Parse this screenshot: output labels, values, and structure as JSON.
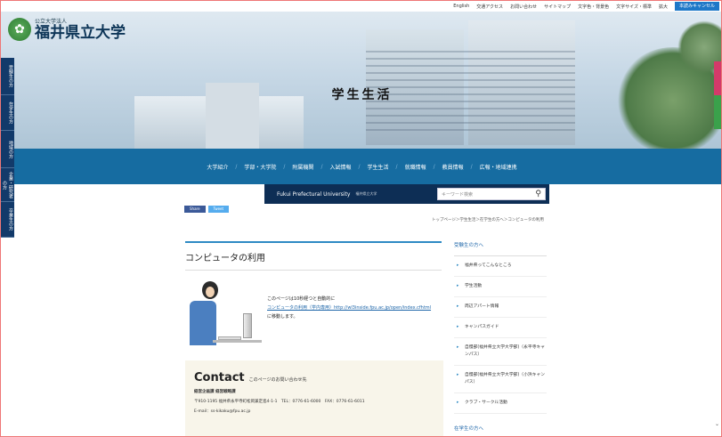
{
  "topbar": {
    "links": [
      "English",
      "交通アクセス",
      "お問い合わせ",
      "サイトマップ",
      "文字色・背景色",
      "文字サイズ・標準",
      "拡大"
    ],
    "cancel_label": "本読みキャンセル"
  },
  "logo": {
    "sub": "公立大学法人",
    "main": "福井県立大学"
  },
  "page_heading": "学生生活",
  "side_tabs": [
    "受験生の方",
    "在学生の方",
    "地域の方",
    "企業・研究者の方",
    "卒業生の方"
  ],
  "nav": {
    "items": [
      "大学紹介",
      "学部・大学院",
      "附属機関",
      "入試情報",
      "学生生活",
      "就職情報",
      "教員情報",
      "広報・地域連携"
    ]
  },
  "subbar": {
    "name": "Fukui Prefectural University",
    "small": "福井県立大学"
  },
  "search": {
    "placeholder": "キーワード検索",
    "icon": "search-icon"
  },
  "share": {
    "facebook": "Share",
    "twitter": "Tweet"
  },
  "breadcrumb": "トップページ＞学生生活＞在学生の方へ＞コンピュータの利用",
  "main": {
    "title": "コンピュータの利用",
    "redirect_line1": "このページは10秒経つと自動的に",
    "redirect_link": "コンピュータの利用（学内専用）http://wl3inside.fpu.ac.jp/open/index.cfhtml",
    "redirect_line3": "に移動します。"
  },
  "contact": {
    "heading": "Contact",
    "subheading": "このページのお問い合わせ先",
    "dept": "経営企画課 経営戦略課",
    "address": "〒910-1195 福井県永平寺町松岡兼定島4-1-1　TEL：0776-61-6000　FAX：0776-61-6011",
    "email": "E-mail：ss-kikaku@fpu.ac.jp"
  },
  "sidebar": {
    "heading": "受験生の方へ",
    "items": [
      "福井県ってこんなところ",
      "学生活動",
      "周辺アパート情報",
      "キャンパスガイド",
      "自慢部(福井県立大学大学部)（永平寺キャンパス）",
      "自慢部(福井県立大学大学部)（小浜キャンパス）",
      "クラブ・サークル活動"
    ],
    "heading2": "在学生の方へ"
  },
  "colors": {
    "nav": "#166ca1",
    "side": "#123a6a",
    "accent": "#2e8ac4"
  }
}
